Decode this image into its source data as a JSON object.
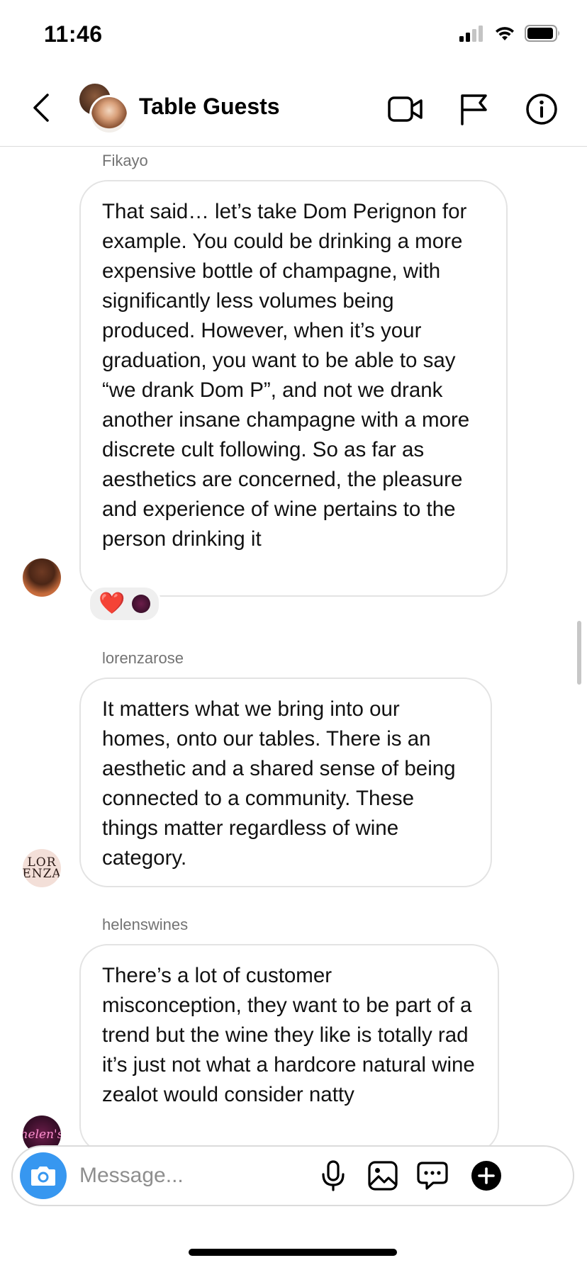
{
  "status_bar": {
    "time": "11:46"
  },
  "header": {
    "title": "Table Guests",
    "icons": [
      "back-chevron-icon",
      "video-call-icon",
      "flag-icon",
      "info-icon"
    ]
  },
  "messages": [
    {
      "sender": "Fikayo",
      "text": "That said… let’s take Dom Perignon for example. You could be drinking a more expensive bottle of champagne, with significantly less volumes being produced. However, when it’s your graduation, you want to be able to say “we drank Dom P”, and not we drank another insane champagne with a more discrete cult following. So as far as aesthetics are concerned, the pleasure and experience of wine pertains to the person drinking it",
      "reactions": [
        "heart-emoji",
        "reactor-avatar"
      ]
    },
    {
      "sender": "lorenzarose",
      "text": "It matters what we bring into our homes, onto our tables. There is an aesthetic and a shared sense of being connected to a community. These things matter regardless of wine category.",
      "avatar_text": "LOR ENZA"
    },
    {
      "sender": "helenswines",
      "text": "There’s a lot of customer misconception, they want to be part of a trend but the wine they like is totally rad it’s just not what a hardcore natural wine zealot would consider natty",
      "avatar_text": "helen's"
    }
  ],
  "reaction_heart": "❤️",
  "composer": {
    "placeholder": "Message...",
    "icons": [
      "camera-icon",
      "microphone-icon",
      "gallery-icon",
      "sticker-chat-icon",
      "plus-icon"
    ]
  },
  "colors": {
    "accent": "#3797f0",
    "bubble_border": "#e3e3e3",
    "name_gray": "#737373",
    "heart": "#ed2024"
  }
}
